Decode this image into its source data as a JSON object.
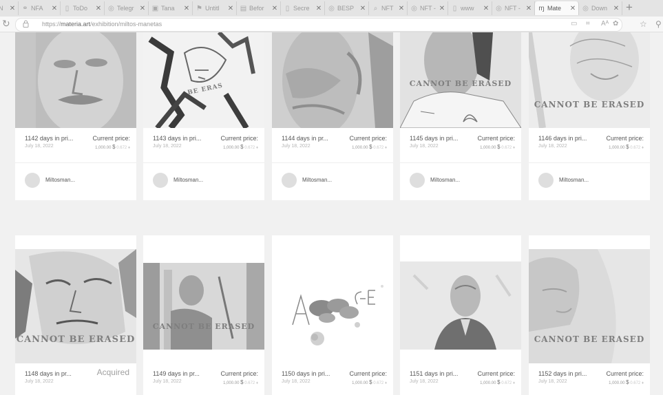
{
  "browser": {
    "tabs": [
      {
        "label": "N",
        "icon": "page-icon"
      },
      {
        "label": "NFA",
        "icon": "nfa-icon"
      },
      {
        "label": "ToDo",
        "icon": "page-icon"
      },
      {
        "label": "Telegr",
        "icon": "globe-icon"
      },
      {
        "label": "Tana",
        "icon": "tana-icon"
      },
      {
        "label": "Untitl",
        "icon": "flag-icon"
      },
      {
        "label": "Befor",
        "icon": "photo-icon"
      },
      {
        "label": "Secre",
        "icon": "page-icon"
      },
      {
        "label": "BESP",
        "icon": "globe-icon"
      },
      {
        "label": "NFT",
        "icon": "search-icon"
      },
      {
        "label": "NFT -",
        "icon": "globe-icon"
      },
      {
        "label": "www",
        "icon": "page-icon"
      },
      {
        "label": "NFT -",
        "icon": "globe-icon"
      },
      {
        "label": "Mate",
        "icon": "materia-icon"
      },
      {
        "label": "Down",
        "icon": "globe-icon"
      }
    ],
    "url_prefix": "https://",
    "url_host": "materia.art",
    "url_path": "/exhibition/miltos-manetas"
  },
  "cards": [
    {
      "days": "1142 days in pri...",
      "date": "July 18, 2022",
      "price_label": "Current price:",
      "usd": "1,000.00",
      "currency": "$",
      "eth": "0.672",
      "owner": "Miltosman...",
      "art_text": "",
      "acquired": ""
    },
    {
      "days": "1143 days in pri...",
      "date": "July 18, 2022",
      "price_label": "Current price:",
      "usd": "1,000.00",
      "currency": "$",
      "eth": "0.672",
      "owner": "Miltosman...",
      "art_text": "BE ERAS",
      "acquired": ""
    },
    {
      "days": "1144 days in pr...",
      "date": "July 18, 2022",
      "price_label": "Current price:",
      "usd": "1,000.00",
      "currency": "$",
      "eth": "0.672",
      "owner": "Miltosman...",
      "art_text": "",
      "acquired": ""
    },
    {
      "days": "1145 days in pri...",
      "date": "July 18, 2022",
      "price_label": "Current price:",
      "usd": "1,000.00",
      "currency": "$",
      "eth": "0.672",
      "owner": "Miltosman...",
      "art_text": "CANNOT BE ERASED",
      "acquired": ""
    },
    {
      "days": "1146 days in pri...",
      "date": "July 18, 2022",
      "price_label": "Current price:",
      "usd": "1,000.00",
      "currency": "$",
      "eth": "0.672",
      "owner": "Miltosman...",
      "art_text": "CANNOT BE ERASED",
      "acquired": ""
    },
    {
      "days": "1148 days in pr...",
      "date": "July 18, 2022",
      "price_label": "",
      "usd": "",
      "currency": "",
      "eth": "",
      "owner": "",
      "art_text": "CANNOT BE ERASED",
      "acquired": "Acquired"
    },
    {
      "days": "1149 days in pr...",
      "date": "July 18, 2022",
      "price_label": "Current price:",
      "usd": "1,000.00",
      "currency": "$",
      "eth": "0.672",
      "owner": "",
      "art_text": "CANNOT BE ERASED",
      "acquired": ""
    },
    {
      "days": "1150 days in pri...",
      "date": "July 18, 2022",
      "price_label": "Current price:",
      "usd": "1,000.00",
      "currency": "$",
      "eth": "0.672",
      "owner": "",
      "art_text": "",
      "acquired": ""
    },
    {
      "days": "1151 days in pri...",
      "date": "July 18, 2022",
      "price_label": "Current price:",
      "usd": "1,000.00",
      "currency": "$",
      "eth": "0.672",
      "owner": "",
      "art_text": "",
      "acquired": ""
    },
    {
      "days": "1152 days in pri...",
      "date": "July 18, 2022",
      "price_label": "Current price:",
      "usd": "1,000.00",
      "currency": "$",
      "eth": "0.672",
      "owner": "",
      "art_text": "CANNOT BE ERASED",
      "acquired": ""
    }
  ]
}
